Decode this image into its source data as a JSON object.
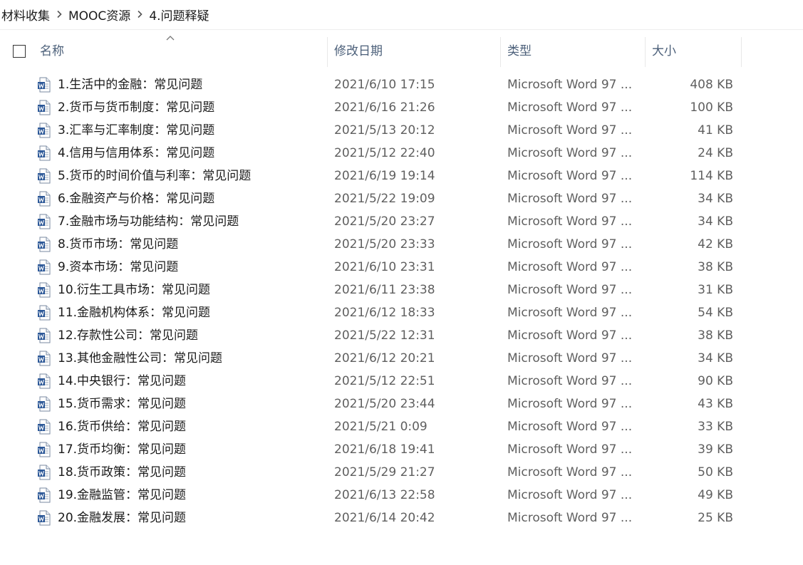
{
  "breadcrumb": {
    "items": [
      "材料收集",
      "MOOC资源",
      "4.问题释疑"
    ]
  },
  "columns": {
    "name": "名称",
    "date": "修改日期",
    "type": "类型",
    "size": "大小"
  },
  "icons": {
    "file_icon": "word-document-icon",
    "separator_icon": "chevron-right-icon",
    "sort_icon": "sort-ascending-caret-icon"
  },
  "colors": {
    "header_text": "#4c607a",
    "word_blue": "#2b5797"
  },
  "files": [
    {
      "name": "1.生活中的金融：常见问题",
      "date": "2021/6/10 17:15",
      "type": "Microsoft Word 97 ...",
      "size": "408 KB"
    },
    {
      "name": "2.货币与货币制度：常见问题",
      "date": "2021/6/16 21:26",
      "type": "Microsoft Word 97 ...",
      "size": "100 KB"
    },
    {
      "name": "3.汇率与汇率制度：常见问题",
      "date": "2021/5/13 20:12",
      "type": "Microsoft Word 97 ...",
      "size": "41 KB"
    },
    {
      "name": "4.信用与信用体系：常见问题",
      "date": "2021/5/12 22:40",
      "type": "Microsoft Word 97 ...",
      "size": "24 KB"
    },
    {
      "name": "5.货币的时间价值与利率：常见问题",
      "date": "2021/6/19 19:14",
      "type": "Microsoft Word 97 ...",
      "size": "114 KB"
    },
    {
      "name": "6.金融资产与价格：常见问题",
      "date": "2021/5/22 19:09",
      "type": "Microsoft Word 97 ...",
      "size": "34 KB"
    },
    {
      "name": "7.金融市场与功能结构：常见问题",
      "date": "2021/5/20 23:27",
      "type": "Microsoft Word 97 ...",
      "size": "34 KB"
    },
    {
      "name": "8.货币市场：常见问题",
      "date": "2021/5/20 23:33",
      "type": "Microsoft Word 97 ...",
      "size": "42 KB"
    },
    {
      "name": "9.资本市场：常见问题",
      "date": "2021/6/10 23:31",
      "type": "Microsoft Word 97 ...",
      "size": "38 KB"
    },
    {
      "name": "10.衍生工具市场：常见问题",
      "date": "2021/6/11 23:38",
      "type": "Microsoft Word 97 ...",
      "size": "31 KB"
    },
    {
      "name": "11.金融机构体系：常见问题",
      "date": "2021/6/12 18:33",
      "type": "Microsoft Word 97 ...",
      "size": "54 KB"
    },
    {
      "name": "12.存款性公司：常见问题",
      "date": "2021/5/22 12:31",
      "type": "Microsoft Word 97 ...",
      "size": "38 KB"
    },
    {
      "name": "13.其他金融性公司：常见问题",
      "date": "2021/6/12 20:21",
      "type": "Microsoft Word 97 ...",
      "size": "34 KB"
    },
    {
      "name": "14.中央银行：常见问题",
      "date": "2021/5/12 22:51",
      "type": "Microsoft Word 97 ...",
      "size": "90 KB"
    },
    {
      "name": "15.货币需求：常见问题",
      "date": "2021/5/20 23:44",
      "type": "Microsoft Word 97 ...",
      "size": "43 KB"
    },
    {
      "name": "16.货币供给：常见问题",
      "date": "2021/5/21 0:09",
      "type": "Microsoft Word 97 ...",
      "size": "33 KB"
    },
    {
      "name": "17.货币均衡：常见问题",
      "date": "2021/6/18 19:41",
      "type": "Microsoft Word 97 ...",
      "size": "39 KB"
    },
    {
      "name": "18.货币政策：常见问题",
      "date": "2021/5/29 21:27",
      "type": "Microsoft Word 97 ...",
      "size": "50 KB"
    },
    {
      "name": "19.金融监管：常见问题",
      "date": "2021/6/13 22:58",
      "type": "Microsoft Word 97 ...",
      "size": "49 KB"
    },
    {
      "name": "20.金融发展：常见问题",
      "date": "2021/6/14 20:42",
      "type": "Microsoft Word 97 ...",
      "size": "25 KB"
    }
  ]
}
